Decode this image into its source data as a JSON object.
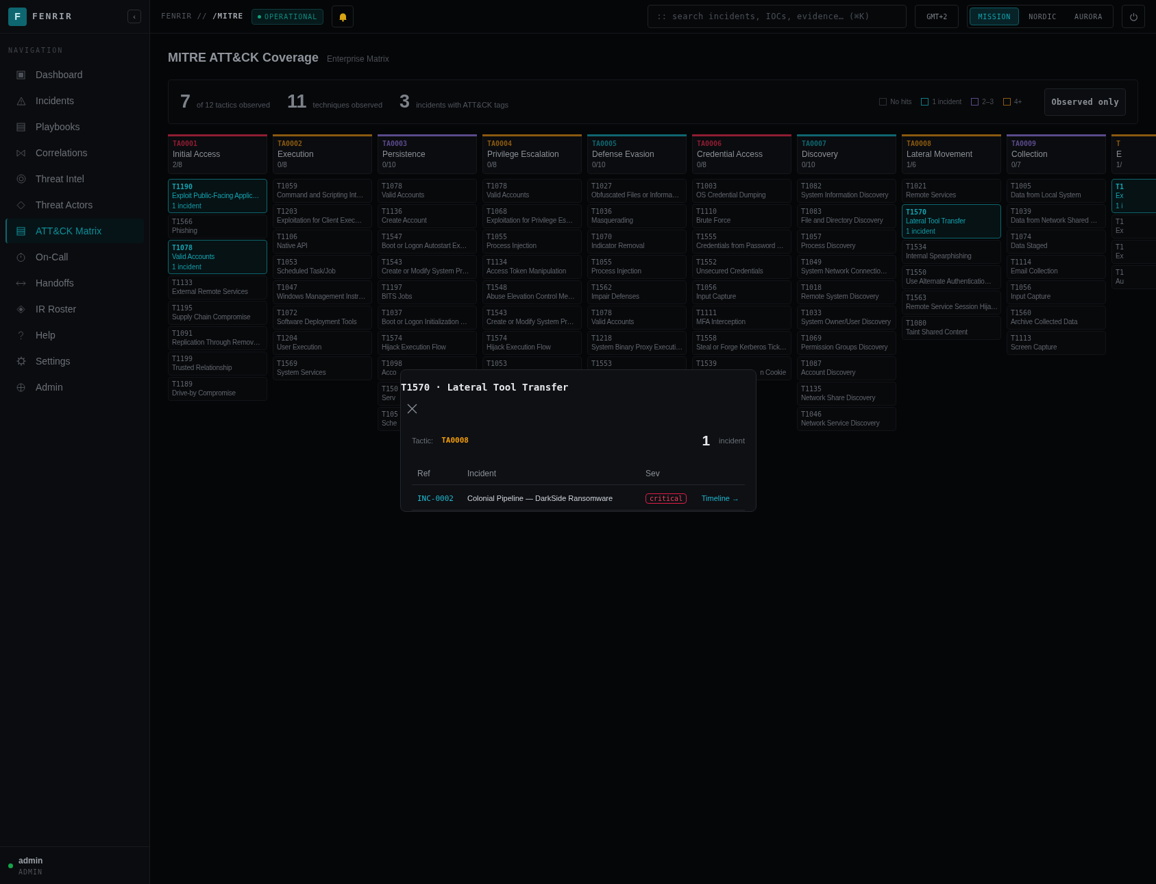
{
  "brand": {
    "logo": "F",
    "name": "FENRIR",
    "collapse": "‹"
  },
  "topbar": {
    "breadcrumb": "FENRIR // ",
    "path": "/MITRE",
    "status": "OPERATIONAL",
    "search": {
      "placeholder": ":: search incidents, IOCs, evidence… (⌘K)"
    },
    "timezone": "GMT+2",
    "themes": [
      {
        "label": "MISSION",
        "selected": true
      },
      {
        "label": "NORDIC",
        "selected": false
      },
      {
        "label": "AURORA",
        "selected": false
      }
    ]
  },
  "sidebar": {
    "heading": "NAVIGATION",
    "items": [
      {
        "label": "Dashboard",
        "selected": false
      },
      {
        "label": "Incidents",
        "selected": false
      },
      {
        "label": "Playbooks",
        "selected": false
      },
      {
        "label": "Correlations",
        "selected": false
      },
      {
        "label": "Threat Intel",
        "selected": false
      },
      {
        "label": "Threat Actors",
        "selected": false
      },
      {
        "label": "ATT&CK Matrix",
        "selected": true
      },
      {
        "label": "On-Call",
        "selected": false
      },
      {
        "label": "Handoffs",
        "selected": false
      },
      {
        "label": "IR Roster",
        "selected": false
      },
      {
        "label": "Help",
        "selected": false
      },
      {
        "label": "Settings",
        "selected": false
      },
      {
        "label": "Admin",
        "selected": false
      }
    ],
    "user": {
      "name": "admin",
      "role": "ADMIN",
      "online": true
    }
  },
  "page": {
    "title": "MITRE ATT&CK Coverage",
    "subtitle": "Enterprise Matrix",
    "stats": [
      {
        "value": "7",
        "label": "of 12 tactics observed"
      },
      {
        "value": "11",
        "label": "techniques observed"
      },
      {
        "value": "3",
        "label": "incidents with ATT&CK tags"
      }
    ],
    "legend": [
      {
        "label": "No hits",
        "color": "#2a2d33"
      },
      {
        "label": "1 incident",
        "color": "#0e7c86"
      },
      {
        "label": "2–3",
        "color": "#5b4a8c"
      },
      {
        "label": "4+",
        "color": "#8a5a10"
      }
    ],
    "filter_button": "Observed only"
  },
  "tactics": [
    {
      "code": "TA0001",
      "name": "Initial Access",
      "count": "2/8",
      "color": "#8f1d33",
      "items": [
        {
          "code": "T1190",
          "name": "Exploit Public-Facing Applic…",
          "hit": true,
          "incidents": "1 incident"
        },
        {
          "code": "T1566",
          "name": "Phishing",
          "hit": false
        },
        {
          "code": "T1078",
          "name": "Valid Accounts",
          "hit": true,
          "incidents": "1 incident"
        },
        {
          "code": "T1133",
          "name": "External Remote Services",
          "hit": false
        },
        {
          "code": "T1195",
          "name": "Supply Chain Compromise",
          "hit": false
        },
        {
          "code": "T1091",
          "name": "Replication Through Remov…",
          "hit": false
        },
        {
          "code": "T1199",
          "name": "Trusted Relationship",
          "hit": false
        },
        {
          "code": "T1189",
          "name": "Drive-by Compromise",
          "hit": false
        }
      ]
    },
    {
      "code": "TA0002",
      "name": "Execution",
      "count": "0/8",
      "color": "#8a5a10",
      "items": [
        {
          "code": "T1059",
          "name": "Command and Scripting Int…",
          "hit": false
        },
        {
          "code": "T1203",
          "name": "Exploitation for Client Exec…",
          "hit": false
        },
        {
          "code": "T1106",
          "name": "Native API",
          "hit": false
        },
        {
          "code": "T1053",
          "name": "Scheduled Task/Job",
          "hit": false
        },
        {
          "code": "T1047",
          "name": "Windows Management Instr…",
          "hit": false
        },
        {
          "code": "T1072",
          "name": "Software Deployment Tools",
          "hit": false
        },
        {
          "code": "T1204",
          "name": "User Execution",
          "hit": false
        },
        {
          "code": "T1569",
          "name": "System Services",
          "hit": false
        }
      ]
    },
    {
      "code": "TA0003",
      "name": "Persistence",
      "count": "0/10",
      "color": "#5b4a8c",
      "items": [
        {
          "code": "T1078",
          "name": "Valid Accounts",
          "hit": false
        },
        {
          "code": "T1136",
          "name": "Create Account",
          "hit": false
        },
        {
          "code": "T1547",
          "name": "Boot or Logon Autostart Ex…",
          "hit": false
        },
        {
          "code": "T1543",
          "name": "Create or Modify System Pr…",
          "hit": false
        },
        {
          "code": "T1197",
          "name": "BITS Jobs",
          "hit": false
        },
        {
          "code": "T1037",
          "name": "Boot or Logon Initialization …",
          "hit": false
        },
        {
          "code": "T1574",
          "name": "Hijack Execution Flow",
          "hit": false
        },
        {
          "code": "T1098",
          "name": "Acco",
          "hit": false
        },
        {
          "code": "T150",
          "name": "Serv",
          "hit": false
        },
        {
          "code": "T105",
          "name": "Sche",
          "hit": false
        }
      ]
    },
    {
      "code": "TA0004",
      "name": "Privilege Escalation",
      "count": "0/8",
      "color": "#8a5a10",
      "items": [
        {
          "code": "T1078",
          "name": "Valid Accounts",
          "hit": false
        },
        {
          "code": "T1068",
          "name": "Exploitation for Privilege Es…",
          "hit": false
        },
        {
          "code": "T1055",
          "name": "Process Injection",
          "hit": false
        },
        {
          "code": "T1134",
          "name": "Access Token Manipulation",
          "hit": false
        },
        {
          "code": "T1548",
          "name": "Abuse Elevation Control Me…",
          "hit": false
        },
        {
          "code": "T1543",
          "name": "Create or Modify System Pr…",
          "hit": false
        },
        {
          "code": "T1574",
          "name": "Hijack Execution Flow",
          "hit": false
        },
        {
          "code": "T1053",
          "hit": false
        }
      ]
    },
    {
      "code": "TA0005",
      "name": "Defense Evasion",
      "count": "0/10",
      "color": "#0e6670",
      "items": [
        {
          "code": "T1027",
          "name": "Obfuscated Files or Informa…",
          "hit": false
        },
        {
          "code": "T1036",
          "name": "Masquerading",
          "hit": false
        },
        {
          "code": "T1070",
          "name": "Indicator Removal",
          "hit": false
        },
        {
          "code": "T1055",
          "name": "Process Injection",
          "hit": false
        },
        {
          "code": "T1562",
          "name": "Impair Defenses",
          "hit": false
        },
        {
          "code": "T1078",
          "name": "Valid Accounts",
          "hit": false
        },
        {
          "code": "T1218",
          "name": "System Binary Proxy Executi…",
          "hit": false
        },
        {
          "code": "T1553",
          "hit": false
        }
      ]
    },
    {
      "code": "TA0006",
      "name": "Credential Access",
      "count": "0/8",
      "color": "#8f1d33",
      "items": [
        {
          "code": "T1003",
          "name": "OS Credential Dumping",
          "hit": false
        },
        {
          "code": "T1110",
          "name": "Brute Force",
          "hit": false
        },
        {
          "code": "T1555",
          "name": "Credentials from Password …",
          "hit": false
        },
        {
          "code": "T1552",
          "name": "Unsecured Credentials",
          "hit": false
        },
        {
          "code": "T1056",
          "name": "Input Capture",
          "hit": false
        },
        {
          "code": "T1111",
          "name": "MFA Interception",
          "hit": false
        },
        {
          "code": "T1558",
          "name": "Steal or Forge Kerberos Tick…",
          "hit": false
        },
        {
          "code": "T1539",
          "name": "n Cookie",
          "hit": false,
          "kind": "cut-start"
        }
      ]
    },
    {
      "code": "TA0007",
      "name": "Discovery",
      "count": "0/10",
      "color": "#0e6670",
      "items": [
        {
          "code": "T1082",
          "name": "System Information Discovery",
          "hit": false
        },
        {
          "code": "T1083",
          "name": "File and Directory Discovery",
          "hit": false
        },
        {
          "code": "T1057",
          "name": "Process Discovery",
          "hit": false
        },
        {
          "code": "T1049",
          "name": "System Network Connectio…",
          "hit": false
        },
        {
          "code": "T1018",
          "name": "Remote System Discovery",
          "hit": false
        },
        {
          "code": "T1033",
          "name": "System Owner/User Discovery",
          "hit": false
        },
        {
          "code": "T1069",
          "name": "Permission Groups Discovery",
          "hit": false
        },
        {
          "code": "T1087",
          "name": "Account Discovery",
          "hit": false
        },
        {
          "code": "T1135",
          "name": "Network Share Discovery",
          "hit": false
        },
        {
          "code": "T1046",
          "name": "Network Service Discovery",
          "hit": false
        }
      ]
    },
    {
      "code": "TA0008",
      "name": "Lateral Movement",
      "count": "1/6",
      "color": "#8a5a10",
      "items": [
        {
          "code": "T1021",
          "name": "Remote Services",
          "hit": false
        },
        {
          "code": "T1570",
          "name": "Lateral Tool Transfer",
          "hit": true,
          "incidents": "1 incident"
        },
        {
          "code": "T1534",
          "name": "Internal Spearphishing",
          "hit": false
        },
        {
          "code": "T1550",
          "name": "Use Alternate Authenticatio…",
          "hit": false
        },
        {
          "code": "T1563",
          "name": "Remote Service Session Hija…",
          "hit": false
        },
        {
          "code": "T1080",
          "name": "Taint Shared Content",
          "hit": false
        }
      ]
    },
    {
      "code": "TA0009",
      "name": "Collection",
      "count": "0/7",
      "color": "#5b4a8c",
      "items": [
        {
          "code": "T1005",
          "name": "Data from Local System",
          "hit": false
        },
        {
          "code": "T1039",
          "name": "Data from Network Shared …",
          "hit": false
        },
        {
          "code": "T1074",
          "name": "Data Staged",
          "hit": false
        },
        {
          "code": "T1114",
          "name": "Email Collection",
          "hit": false
        },
        {
          "code": "T1056",
          "name": "Input Capture",
          "hit": false
        },
        {
          "code": "T1560",
          "name": "Archive Collected Data",
          "hit": false
        },
        {
          "code": "T1113",
          "name": "Screen Capture",
          "hit": false
        }
      ]
    },
    {
      "code": "T",
      "name": "E",
      "count": "1/",
      "color": "#8a5a10",
      "items": [
        {
          "code": "T1",
          "name": "Ex",
          "hit": true,
          "incidents": "1 i"
        },
        {
          "code": "T1",
          "name": "Ex",
          "hit": false
        },
        {
          "code": "T1",
          "name": "Ex",
          "hit": false
        },
        {
          "code": "T1",
          "name": "Au",
          "hit": false
        }
      ]
    }
  ],
  "modal": {
    "title": "T1570 · Lateral Tool Transfer",
    "tactic_label": "Tactic:",
    "tactic": "TA0008",
    "count": "1",
    "count_label": "incident",
    "columns": [
      "Ref",
      "Incident",
      "Sev"
    ],
    "rows": [
      {
        "ref": "INC-0002",
        "incident": "Colonial Pipeline — DarkSide Ransomware",
        "severity": "critical",
        "link": "Timeline →"
      }
    ]
  }
}
